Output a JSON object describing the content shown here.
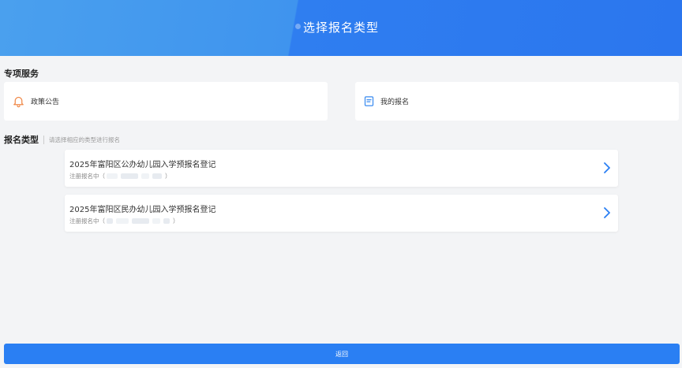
{
  "header": {
    "title": "选择报名类型"
  },
  "special_services": {
    "title": "专项服务",
    "items": [
      {
        "label": "政策公告",
        "icon": "bell-icon"
      },
      {
        "label": "我的报名",
        "icon": "document-icon"
      }
    ]
  },
  "registration_types": {
    "title": "报名类型",
    "hint": "请选择相应的类型进行报名",
    "items": [
      {
        "name": "2025年富阳区公办幼儿园入学预报名登记",
        "status": "注册报名中（",
        "status_end": "）"
      },
      {
        "name": "2025年富阳区民办幼儿园入学预报名登记",
        "status": "注册报名中（",
        "status_end": "）"
      }
    ]
  },
  "footer": {
    "back_label": "返回"
  },
  "colors": {
    "primary": "#2a7ff3",
    "bell": "#f08a4b",
    "doc": "#3b8cf0"
  }
}
